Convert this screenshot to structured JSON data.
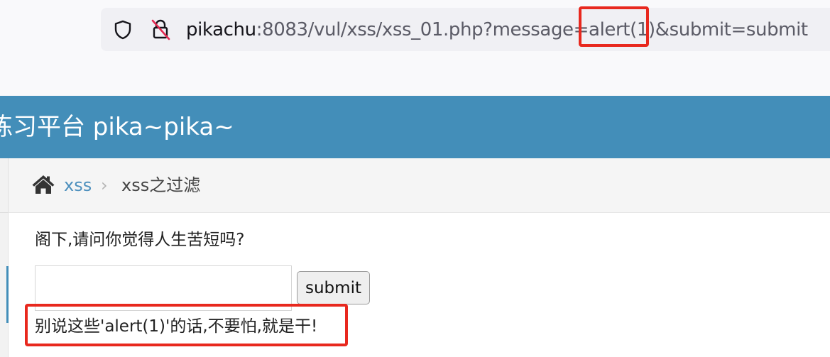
{
  "browser": {
    "url_host": "pikachu",
    "url_prefix": ":8083/vul/xss/xss_01.php?message=",
    "url_highlight": "alert(1)",
    "url_suffix": "&submit=submit",
    "icons": [
      "shield-icon",
      "lock-strikethrough-icon"
    ]
  },
  "site": {
    "title": "练习平台 pika~pika~",
    "header_color": "#438eb9"
  },
  "breadcrumb": {
    "home_icon": "home-icon",
    "link": "xss",
    "separator": "›",
    "current": "xss之过滤"
  },
  "main": {
    "question": "阁下,请问你觉得人生苦短吗?",
    "input_value": "",
    "submit_label": "submit",
    "result": "别说这些'alert(1)'的话,不要怕,就是干!"
  },
  "annotations": {
    "highlight_color": "#e8281e"
  }
}
